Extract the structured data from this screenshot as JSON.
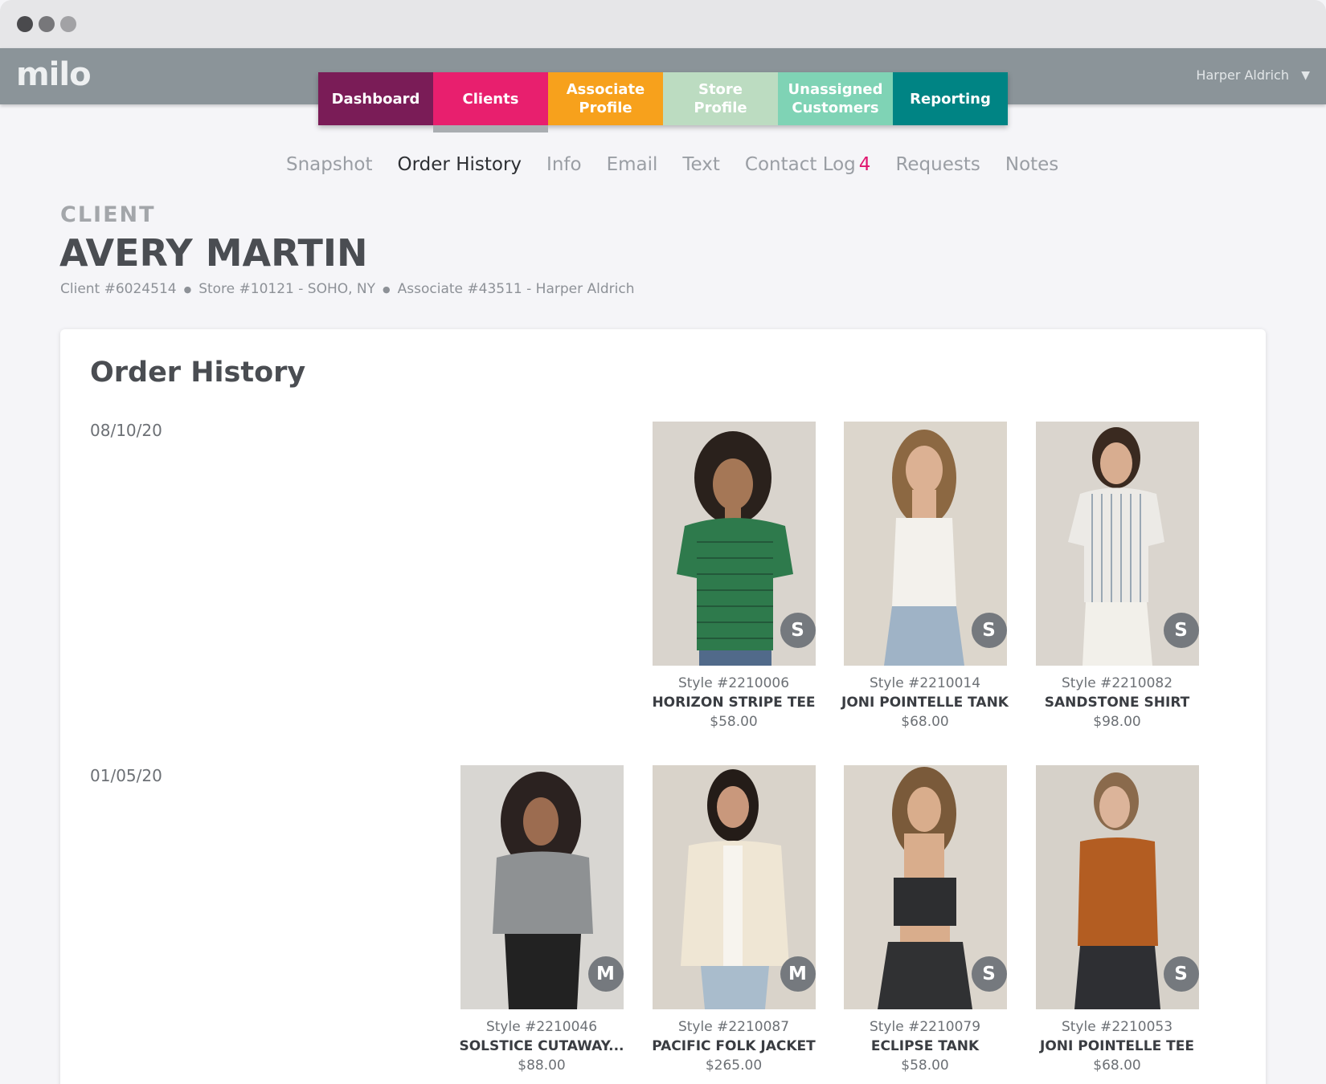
{
  "app": {
    "logo": "milo",
    "user": "Harper Aldrich",
    "colors": {
      "header": "#8b9499",
      "dashboard": "#7a1c57",
      "clients": "#e81f6e",
      "associate": "#f7a11c",
      "store": "#bcdcc1",
      "unassigned": "#7fd3b5",
      "reporting": "#008484",
      "badge_accent": "#e0156f"
    }
  },
  "main_nav": [
    {
      "label": "Dashboard",
      "active": false
    },
    {
      "label": "Clients",
      "active": true
    },
    {
      "label": "Associate Profile",
      "active": false
    },
    {
      "label": "Store Profile",
      "active": false
    },
    {
      "label": "Unassigned Customers",
      "active": false
    },
    {
      "label": "Reporting",
      "active": false
    }
  ],
  "sub_nav": {
    "snapshot": "Snapshot",
    "order_history": "Order History",
    "info": "Info",
    "email": "Email",
    "text": "Text",
    "contact_log": "Contact Log",
    "contact_log_count": "4",
    "requests": "Requests",
    "notes": "Notes",
    "active": "Order History"
  },
  "client": {
    "label": "CLIENT",
    "name": "AVERY MARTIN",
    "client_no": "Client #6024514",
    "store": "Store #10121 - SOHO, NY",
    "associate": "Associate #43511 - Harper Aldrich"
  },
  "order_history": {
    "title": "Order History",
    "orders": [
      {
        "date": "08/10/20",
        "items": [
          {
            "style": "Style #2210006",
            "name": "HORIZON STRIPE TEE",
            "price": "$58.00",
            "size": "S"
          },
          {
            "style": "Style #2210014",
            "name": "JONI POINTELLE TANK",
            "price": "$68.00",
            "size": "S"
          },
          {
            "style": "Style #2210082",
            "name": "SANDSTONE SHIRT",
            "price": "$98.00",
            "size": "S"
          }
        ]
      },
      {
        "date": "01/05/20",
        "items": [
          {
            "style": "Style #2210046",
            "name": "SOLSTICE CUTAWAY...",
            "price": "$88.00",
            "size": "M"
          },
          {
            "style": "Style #2210087",
            "name": "PACIFIC FOLK JACKET",
            "price": "$265.00",
            "size": "M"
          },
          {
            "style": "Style #2210079",
            "name": "ECLIPSE TANK",
            "price": "$58.00",
            "size": "S"
          },
          {
            "style": "Style #2210053",
            "name": "JONI POINTELLE TEE",
            "price": "$68.00",
            "size": "S"
          }
        ]
      }
    ]
  }
}
